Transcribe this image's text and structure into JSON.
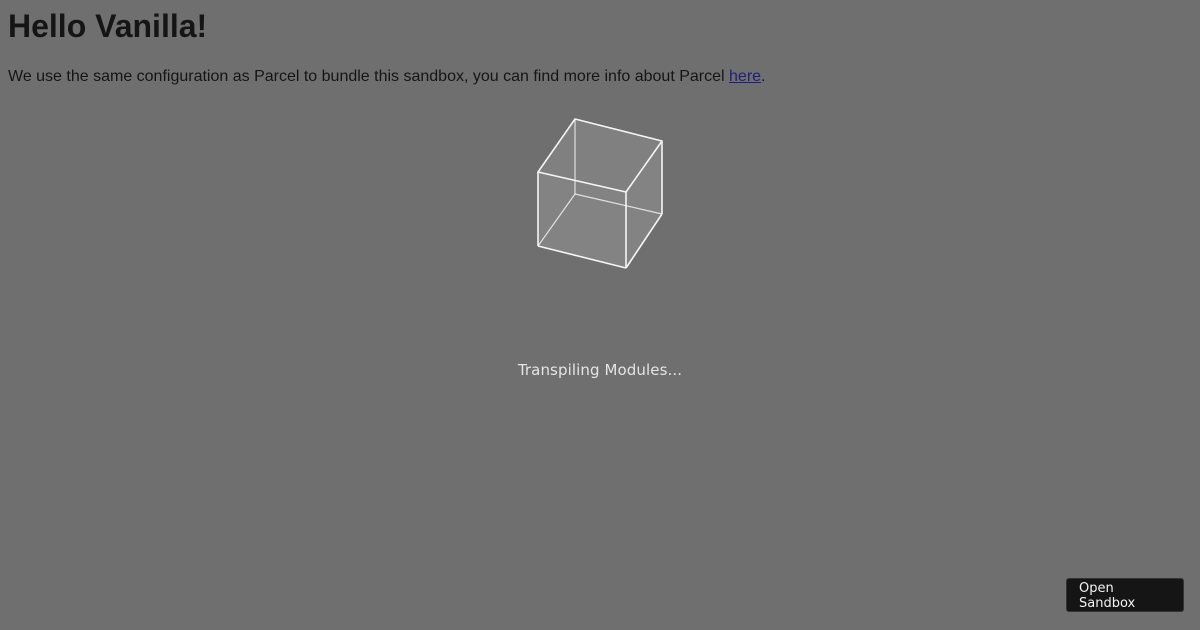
{
  "page": {
    "title": "Hello Vanilla!",
    "intro_text": "We use the same configuration as Parcel to bundle this sandbox, you can find more info about Parcel ",
    "intro_link": "here",
    "intro_end": "."
  },
  "loader": {
    "icon": "cube-icon",
    "status": "Transpiling Modules..."
  },
  "sandbox_button": {
    "label": "Open Sandbox"
  },
  "colors": {
    "background": "#6f6f6f",
    "text": "#151515",
    "link": "#1f1e7a",
    "loader_text": "#e4e4e4",
    "button_bg": "#151515"
  }
}
